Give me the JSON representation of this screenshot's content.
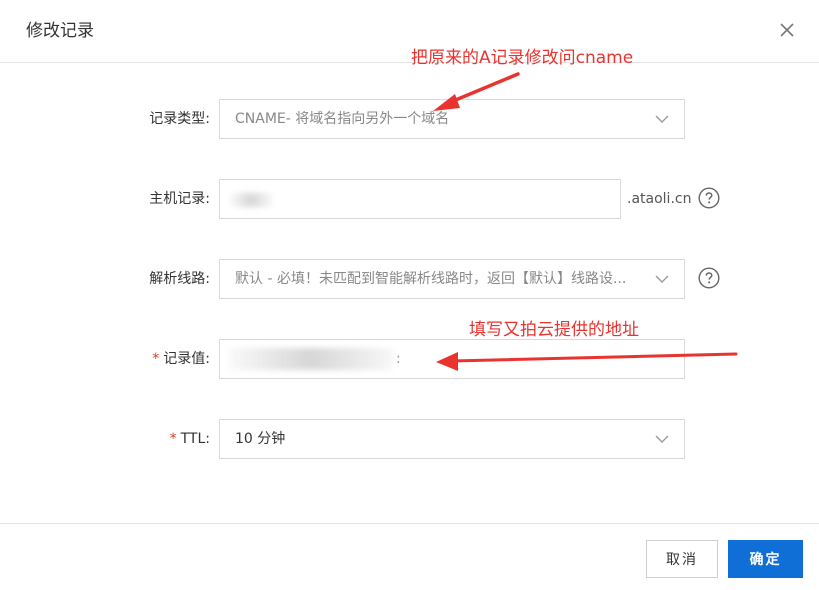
{
  "dialog": {
    "title": "修改记录",
    "close_icon": "close-icon"
  },
  "form": {
    "record_type": {
      "label": "记录类型:",
      "value": "CNAME- 将域名指向另外一个域名"
    },
    "host_record": {
      "label": "主机记录:",
      "suffix": ".ataoli.cn"
    },
    "line": {
      "label": "解析线路:",
      "value": "默认 - 必填！未匹配到智能解析线路时，返回【默认】线路设..."
    },
    "record_value": {
      "required_mark": "*",
      "label": "记录值:",
      "value": ":"
    },
    "ttl": {
      "required_mark": "*",
      "label": "TTL:",
      "value": "10 分钟"
    }
  },
  "annotations": {
    "type_note": "把原来的A记录修改问cname",
    "value_note": "填写又拍云提供的地址",
    "color": "#e8332f"
  },
  "footer": {
    "cancel_label": "取消",
    "confirm_label": "确定",
    "confirm_color": "#0f6fd6"
  }
}
